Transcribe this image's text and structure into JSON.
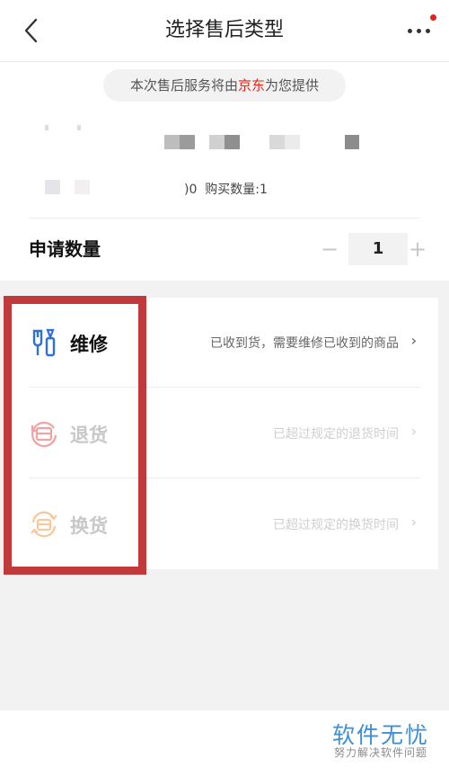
{
  "header": {
    "title": "选择售后类型",
    "back_icon": "chevron-left-icon",
    "more_icon": "more-dots-icon"
  },
  "notice": {
    "prefix": "本次售后服务将由",
    "provider": "京东",
    "suffix": "为您提供",
    "provider_color": "#e1251b"
  },
  "product": {
    "quantity_fragment": ")0",
    "purchase_qty_text": "购买数量:1"
  },
  "apply": {
    "label": "申请数量",
    "minus": "−",
    "value": "1",
    "plus": "+"
  },
  "service_types": [
    {
      "label": "维修",
      "description": "已收到货，需要维修已收到的商品",
      "chevron": "›",
      "icon": "wrench-icon",
      "enabled": true
    },
    {
      "label": "退货",
      "description": "已超过规定的退货时间",
      "chevron": "›",
      "icon": "return-icon",
      "enabled": false
    },
    {
      "label": "换货",
      "description": "已超过规定的换货时间",
      "chevron": "›",
      "icon": "exchange-icon",
      "enabled": false
    }
  ],
  "watermark": {
    "title": "软件无忧",
    "subtitle": "努力解决软件问题"
  },
  "colors": {
    "accent_red": "#e1251b",
    "highlight_box": "#c0393b",
    "icon_blue": "#2f6fd8",
    "icon_pink": "#f3a1a1",
    "icon_orange": "#f6c89a",
    "watermark_blue": "#3d8fd8"
  }
}
